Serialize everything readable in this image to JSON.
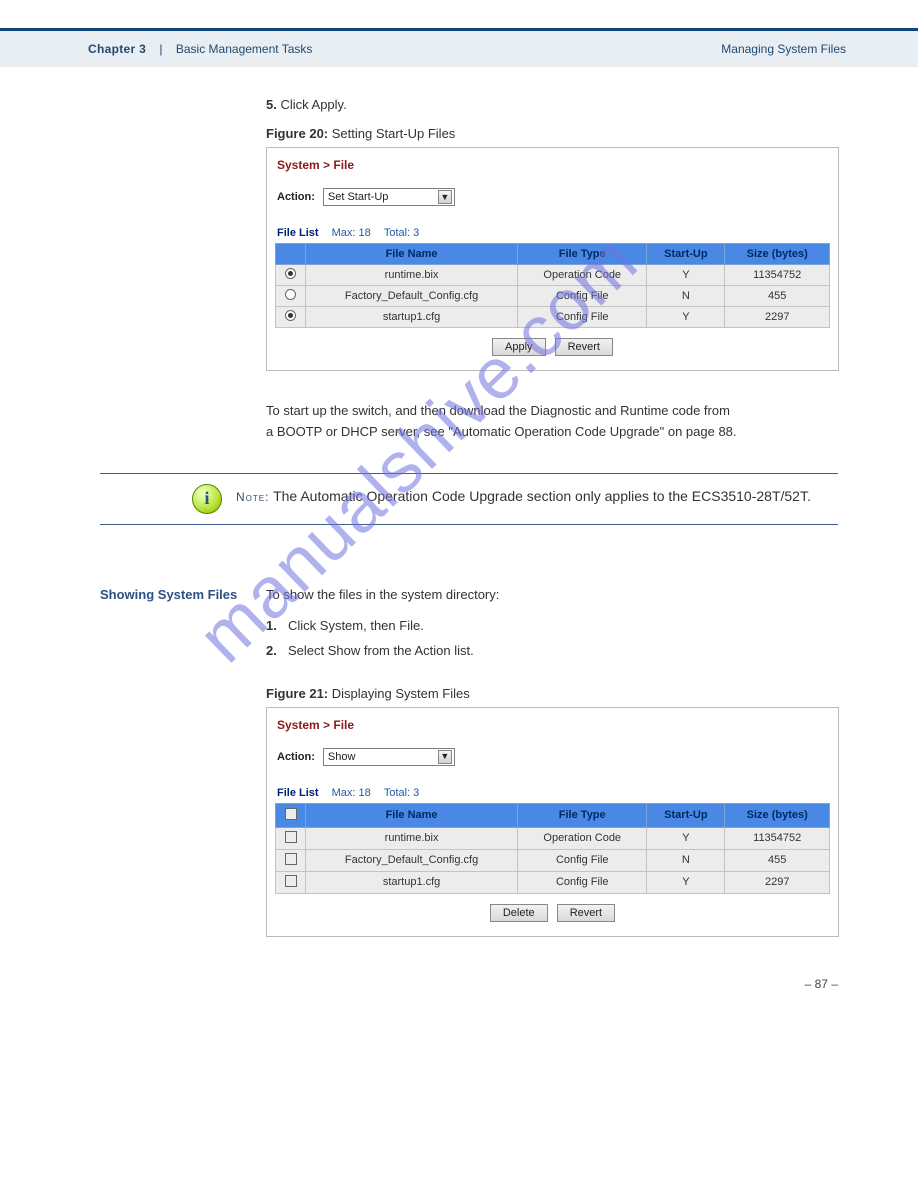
{
  "chapter": {
    "left": "Chapter 3",
    "sep": "|",
    "right": "Basic Management Tasks",
    "sub": "Managing System Files"
  },
  "intro1": "Click Apply.",
  "intro1_num": "5.",
  "fig1": {
    "label": "Figure 20:",
    "title": "Setting Start-Up Files"
  },
  "panel1": {
    "crumb": "System > File",
    "action_label": "Action:",
    "action_value": "Set Start-Up",
    "list_label": "File List",
    "max_label": "Max: 18",
    "total_label": "Total: 3",
    "headers": {
      "name": "File Name",
      "type": "File Type",
      "start": "Start-Up",
      "size": "Size (bytes)"
    },
    "rows": [
      {
        "sel": true,
        "name": "runtime.bix",
        "type": "Operation Code",
        "start": "Y",
        "size": "11354752"
      },
      {
        "sel": false,
        "name": "Factory_Default_Config.cfg",
        "type": "Config File",
        "start": "N",
        "size": "455"
      },
      {
        "sel": true,
        "name": "startup1.cfg",
        "type": "Config File",
        "start": "Y",
        "size": "2297"
      }
    ],
    "btn_apply": "Apply",
    "btn_revert": "Revert"
  },
  "auto_line1": "To start up the switch, and then download the Diagnostic and Runtime code from",
  "auto_line2": "a BOOTP or DHCP server, see",
  "auto_line_link": "\"Automatic Operation Code Upgrade\" on page 88",
  "note": {
    "label": "Note:",
    "text": "The Automatic Operation Code Upgrade section only applies to the ECS3510-28T/52T."
  },
  "show": {
    "heading": "Showing System Files",
    "intro": "To show the files in the system directory:",
    "s1": "Click System, then File.",
    "s2": "Select Show from the Action list.",
    "s1n": "1.",
    "s2n": "2."
  },
  "fig2": {
    "label": "Figure 21:",
    "title": "Displaying System Files"
  },
  "panel2": {
    "crumb": "System > File",
    "action_label": "Action:",
    "action_value": "Show",
    "list_label": "File List",
    "max_label": "Max: 18",
    "total_label": "Total: 3",
    "headers": {
      "name": "File Name",
      "type": "File Type",
      "start": "Start-Up",
      "size": "Size (bytes)"
    },
    "rows": [
      {
        "name": "runtime.bix",
        "type": "Operation Code",
        "start": "Y",
        "size": "11354752"
      },
      {
        "name": "Factory_Default_Config.cfg",
        "type": "Config File",
        "start": "N",
        "size": "455"
      },
      {
        "name": "startup1.cfg",
        "type": "Config File",
        "start": "Y",
        "size": "2297"
      }
    ],
    "btn_delete": "Delete",
    "btn_revert": "Revert"
  },
  "watermark": "manualshive.com",
  "page": "– 87 –"
}
